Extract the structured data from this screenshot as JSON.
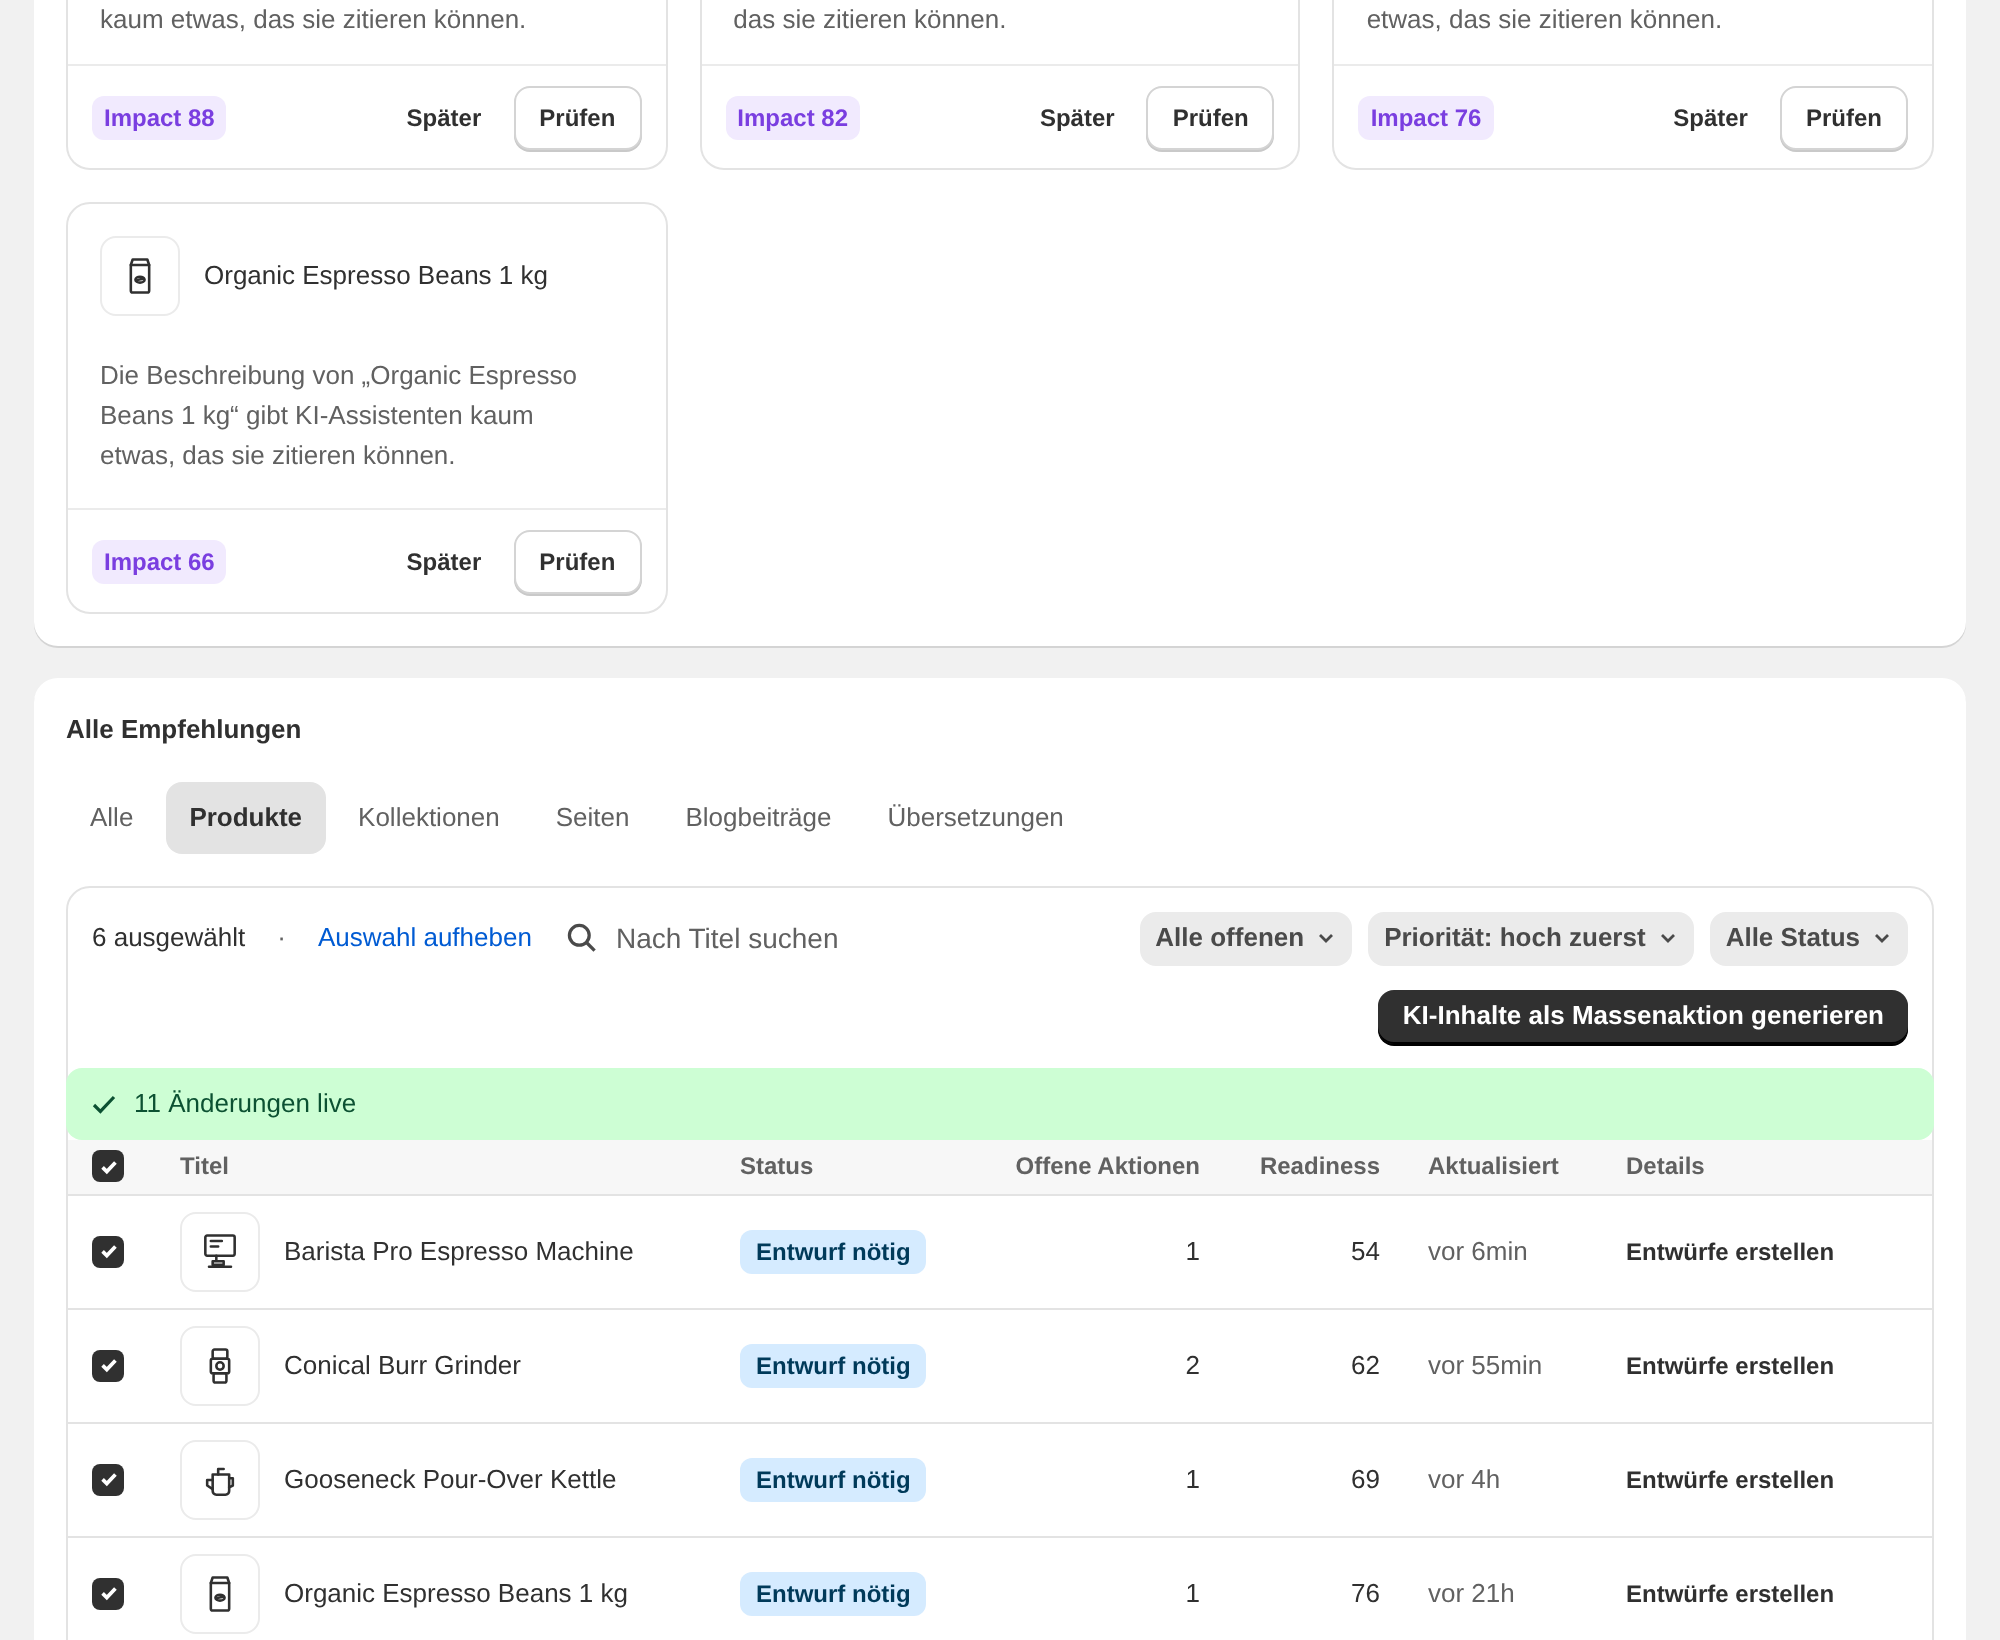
{
  "suggestion_cards": [
    {
      "description": "kaum etwas, das sie zitieren können.",
      "impact": "Impact 88",
      "later": "Später",
      "review": "Prüfen"
    },
    {
      "description": "das sie zitieren können.",
      "impact": "Impact 82",
      "later": "Später",
      "review": "Prüfen"
    },
    {
      "description": "etwas, das sie zitieren können.",
      "impact": "Impact 76",
      "later": "Später",
      "review": "Prüfen"
    },
    {
      "title": "Organic Espresso Beans 1 kg",
      "description": "Die Beschreibung von „Organic Espresso Beans 1 kg“ gibt KI-Assistenten kaum etwas, das sie zitieren können.",
      "impact": "Impact 66",
      "later": "Später",
      "review": "Prüfen"
    }
  ],
  "recommendations": {
    "title": "Alle Empfehlungen",
    "tabs": [
      {
        "label": "Alle",
        "selected": false
      },
      {
        "label": "Produkte",
        "selected": true
      },
      {
        "label": "Kollektionen",
        "selected": false
      },
      {
        "label": "Seiten",
        "selected": false
      },
      {
        "label": "Blogbeiträge",
        "selected": false
      },
      {
        "label": "Übersetzungen",
        "selected": false
      }
    ],
    "selection_count": "6 ausgewählt",
    "separator": "·",
    "clear_selection": "Auswahl aufheben",
    "search": {
      "placeholder": "Nach Titel suchen"
    },
    "filters": [
      "Alle offenen",
      "Priorität: hoch zuerst",
      "Alle Status"
    ],
    "bulk_action": "KI-Inhalte als Massenaktion generieren",
    "banner": "11 Änderungen live",
    "table": {
      "select_all_checked": true,
      "columns": [
        "Titel",
        "Status",
        "Offene Aktionen",
        "Readiness",
        "Aktualisiert",
        "Details"
      ],
      "rows": [
        {
          "checked": true,
          "title": "Barista Pro Espresso Machine",
          "status": "Entwurf nötig",
          "open_actions": "1",
          "readiness": "54",
          "updated": "vor 6min",
          "action": "Entwürfe erstellen"
        },
        {
          "checked": true,
          "title": "Conical Burr Grinder",
          "status": "Entwurf nötig",
          "open_actions": "2",
          "readiness": "62",
          "updated": "vor 55min",
          "action": "Entwürfe erstellen"
        },
        {
          "checked": true,
          "title": "Gooseneck Pour-Over Kettle",
          "status": "Entwurf nötig",
          "open_actions": "1",
          "readiness": "69",
          "updated": "vor 4h",
          "action": "Entwürfe erstellen"
        },
        {
          "checked": true,
          "title": "Organic Espresso Beans 1 kg",
          "status": "Entwurf nötig",
          "open_actions": "1",
          "readiness": "76",
          "updated": "vor 21h",
          "action": "Entwürfe erstellen"
        }
      ]
    }
  }
}
